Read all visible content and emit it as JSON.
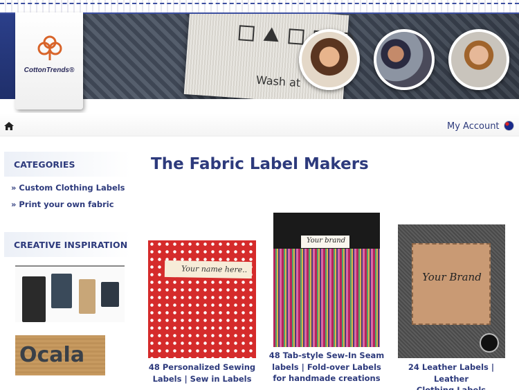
{
  "header": {
    "brand": "CottonTrends®",
    "banner_label_text": "Wash at",
    "accent_color": "#2d3a7c",
    "brand_red": "#c91f25"
  },
  "nav": {
    "home_icon": "home-icon",
    "my_account": "My Account",
    "flag_icon": "australia-flag-icon"
  },
  "sidebar": {
    "categories_heading": "CATEGORIES",
    "categories": [
      "» Custom Clothing Labels",
      "» Print your own fabric"
    ],
    "inspiration_heading": "CREATIVE INSPIRATION",
    "inspiration_tag_text": "Ocala"
  },
  "main": {
    "title": "The Fabric Label Makers",
    "products": [
      {
        "image_text": "Your name here..",
        "caption_line1": "48 Personalized Sewing",
        "caption_line2": "Labels | Sew in Labels"
      },
      {
        "image_text": "Your brand",
        "caption_line1": "48 Tab-style Sew-In Seam",
        "caption_line2": "labels | Fold-over Labels",
        "caption_line3": "for handmade creations"
      },
      {
        "image_text": "Your Brand",
        "caption_line1": "24 Leather Labels | Leather",
        "caption_line2": "Clothing Labels"
      }
    ]
  }
}
